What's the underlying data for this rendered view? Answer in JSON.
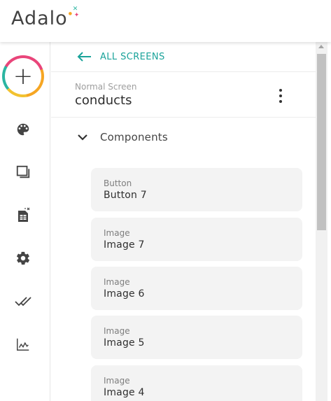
{
  "app": {
    "logo_text": "Adalo",
    "colors": {
      "teal": "#1aa39a",
      "pink": "#e9457a",
      "orange": "#f6a623",
      "yellow": "#f2c230"
    }
  },
  "rail": {
    "add_label": "+",
    "items": [
      {
        "name": "palette-icon"
      },
      {
        "name": "screens-icon"
      },
      {
        "name": "database-icon"
      },
      {
        "name": "gear-icon"
      },
      {
        "name": "publish-icon"
      },
      {
        "name": "analytics-icon"
      }
    ]
  },
  "panel": {
    "back_label": "ALL SCREENS",
    "screen_type": "Normal Screen",
    "screen_name": "conducts",
    "components_label": "Components",
    "components": [
      {
        "type": "Button",
        "name": "Button 7"
      },
      {
        "type": "Image",
        "name": "Image 7"
      },
      {
        "type": "Image",
        "name": "Image 6"
      },
      {
        "type": "Image",
        "name": "Image 5"
      },
      {
        "type": "Image",
        "name": "Image 4"
      }
    ]
  }
}
